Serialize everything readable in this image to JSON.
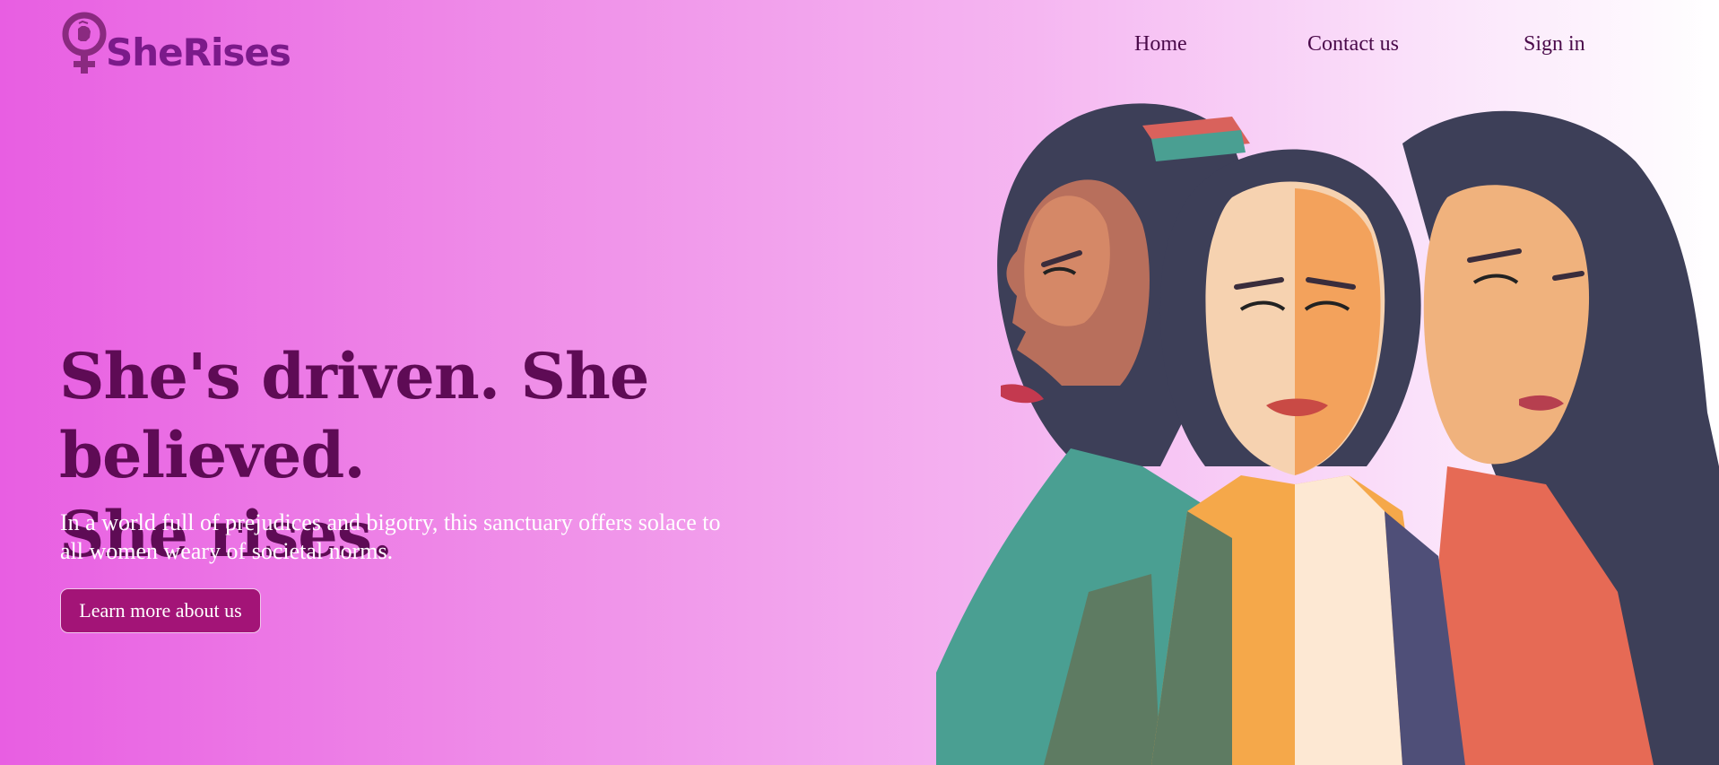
{
  "brand": {
    "name": "SheRises",
    "logo_icon": "venus-fist-icon",
    "color": "#7b1a8a"
  },
  "nav": {
    "items": [
      {
        "label": "Home"
      },
      {
        "label": "Contact us"
      },
      {
        "label": "Sign in"
      }
    ]
  },
  "hero": {
    "title_line1": "She's driven. She believed.",
    "title_line2": "She rises.",
    "description": "In a world full of prejudices and bigotry, this sanctuary offers solace to all women weary of societal norms.",
    "cta_label": "Learn more about us",
    "illustration": "three-women-illustration"
  },
  "colors": {
    "title": "#5e0b55",
    "cta_background": "#a31477",
    "gradient_start": "#e85ee2",
    "gradient_end": "#ffffff"
  }
}
